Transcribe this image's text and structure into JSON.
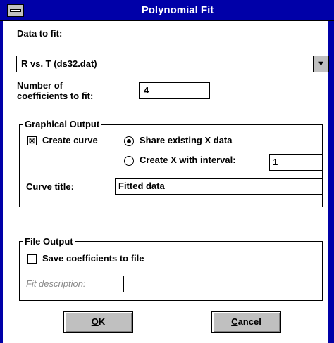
{
  "window": {
    "title": "Polynomial Fit",
    "sysmenu_icon": "minus-bar-icon",
    "frame_color": "#0000a8"
  },
  "data_to_fit": {
    "label": "Data to fit:",
    "selected": "R vs. T (ds32.dat)",
    "arrow_glyph": "▼"
  },
  "coefficients": {
    "label_line1": "Number of",
    "label_line2": "coefficients to fit:",
    "value": "4"
  },
  "graphical_output": {
    "title": "Graphical Output",
    "create_curve": {
      "label": "Create curve",
      "checked": true,
      "mark": "⊠"
    },
    "share_x": {
      "label": "Share existing X data",
      "selected": true
    },
    "create_x": {
      "label": "Create X with interval:",
      "selected": false
    },
    "interval_value": "1",
    "curve_title_label": "Curve title:",
    "curve_title_value": "Fitted data"
  },
  "file_output": {
    "title": "File Output",
    "save_coeffs": {
      "label": "Save coefficients to file",
      "checked": false
    },
    "fit_description_label": "Fit description:",
    "fit_description_value": ""
  },
  "buttons": {
    "ok_mnemonic": "O",
    "ok_rest": "K",
    "cancel_mnemonic": "C",
    "cancel_rest": "ancel"
  }
}
